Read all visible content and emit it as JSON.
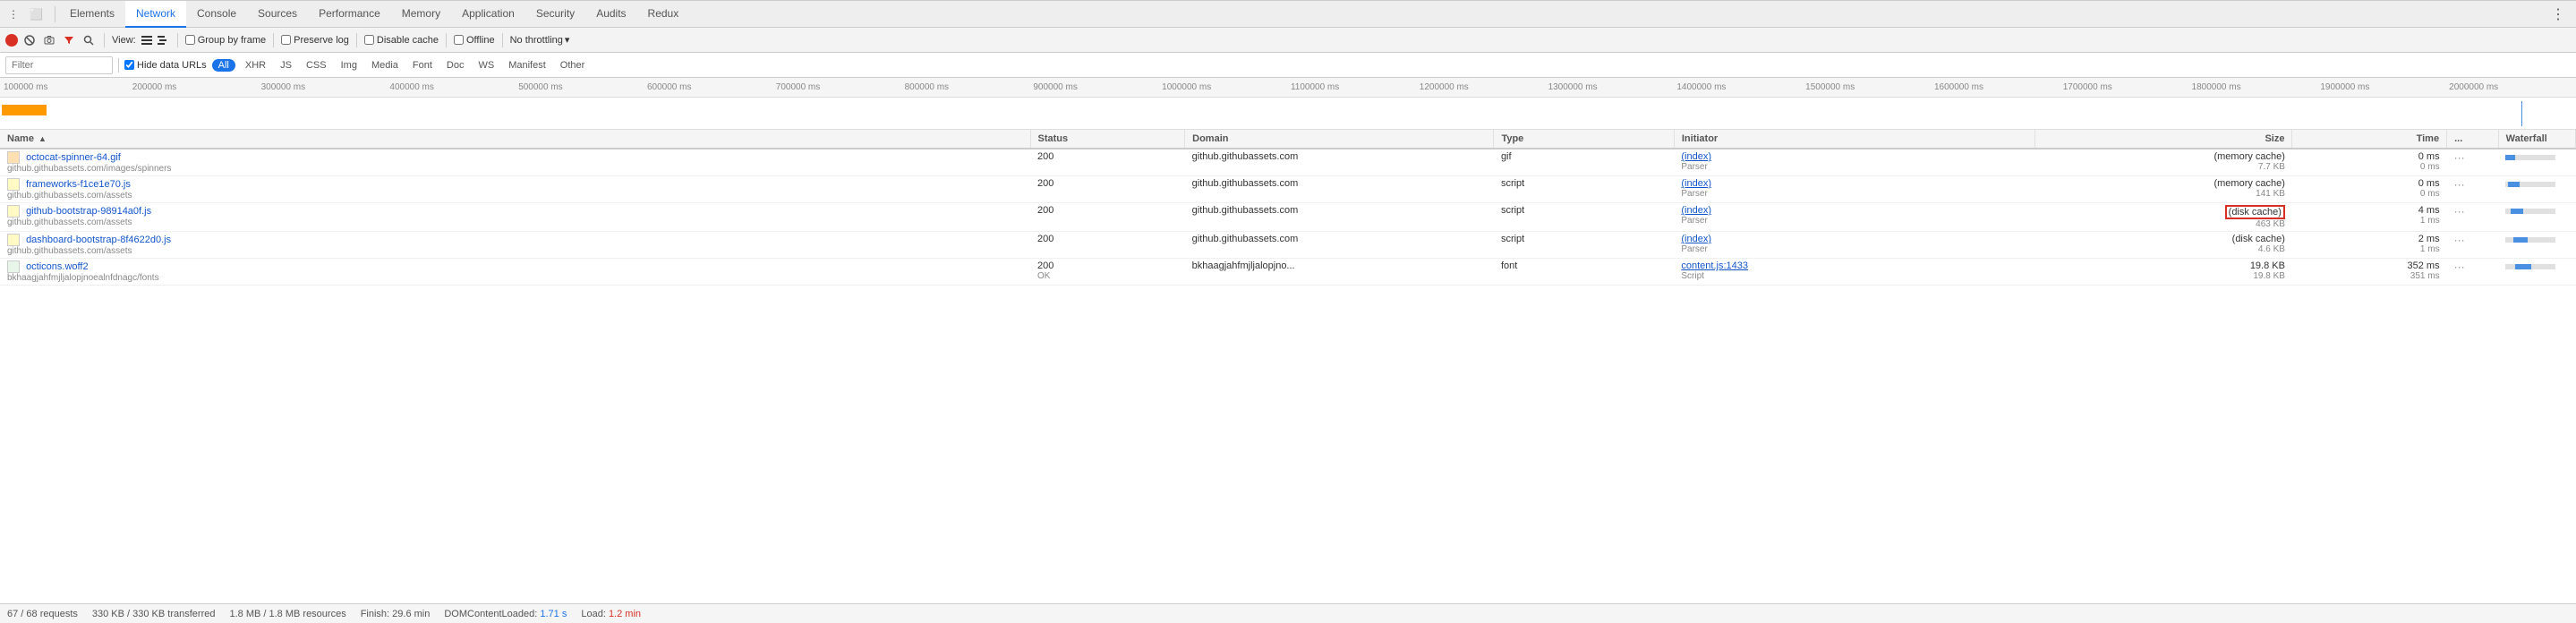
{
  "tabs": [
    {
      "id": "elements",
      "label": "Elements",
      "active": false
    },
    {
      "id": "network",
      "label": "Network",
      "active": true
    },
    {
      "id": "console",
      "label": "Console",
      "active": false
    },
    {
      "id": "sources",
      "label": "Sources",
      "active": false
    },
    {
      "id": "performance",
      "label": "Performance",
      "active": false
    },
    {
      "id": "memory",
      "label": "Memory",
      "active": false
    },
    {
      "id": "application",
      "label": "Application",
      "active": false
    },
    {
      "id": "security",
      "label": "Security",
      "active": false
    },
    {
      "id": "audits",
      "label": "Audits",
      "active": false
    },
    {
      "id": "redux",
      "label": "Redux",
      "active": false
    }
  ],
  "toolbar": {
    "view_label": "View:",
    "group_by_frame": "Group by frame",
    "preserve_log": "Preserve log",
    "disable_cache": "Disable cache",
    "offline": "Offline",
    "no_throttling": "No throttling"
  },
  "filter": {
    "placeholder": "Filter",
    "hide_data_urls": "Hide data URLs",
    "all_label": "All",
    "types": [
      "XHR",
      "JS",
      "CSS",
      "Img",
      "Media",
      "Font",
      "Doc",
      "WS",
      "Manifest",
      "Other"
    ]
  },
  "timeline": {
    "ticks": [
      "100000 ms",
      "200000 ms",
      "300000 ms",
      "400000 ms",
      "500000 ms",
      "600000 ms",
      "700000 ms",
      "800000 ms",
      "900000 ms",
      "1000000 ms",
      "1100000 ms",
      "1200000 ms",
      "1300000 ms",
      "1400000 ms",
      "1500000 ms",
      "1600000 ms",
      "1700000 ms",
      "1800000 ms",
      "1900000 ms",
      "2000000 ms"
    ]
  },
  "table": {
    "headers": [
      "Name",
      "Status",
      "Domain",
      "Type",
      "Initiator",
      "Size",
      "Time",
      "...",
      "Waterfall"
    ],
    "rows": [
      {
        "id": 1,
        "name": "octocat-spinner-64.gif",
        "path": "github.githubassets.com/images/spinners",
        "type_icon": "gif",
        "status": "200",
        "status_sub": "",
        "domain": "github.githubassets.com",
        "type": "gif",
        "initiator": "(index)",
        "initiator_sub": "Parser",
        "size_main": "(memory cache)",
        "size_sub": "7.7 KB",
        "time_main": "0 ms",
        "time_sub": "0 ms",
        "highlight": false
      },
      {
        "id": 2,
        "name": "frameworks-f1ce1e70.js",
        "path": "github.githubassets.com/assets",
        "type_icon": "script",
        "status": "200",
        "status_sub": "",
        "domain": "github.githubassets.com",
        "type": "script",
        "initiator": "(index)",
        "initiator_sub": "Parser",
        "size_main": "(memory cache)",
        "size_sub": "141 KB",
        "time_main": "0 ms",
        "time_sub": "0 ms",
        "highlight": false
      },
      {
        "id": 3,
        "name": "github-bootstrap-98914a0f.js",
        "path": "github.githubassets.com/assets",
        "type_icon": "script",
        "status": "200",
        "status_sub": "",
        "domain": "github.githubassets.com",
        "type": "script",
        "initiator": "(index)",
        "initiator_sub": "Parser",
        "size_main": "(disk cache)",
        "size_sub": "463 KB",
        "time_main": "4 ms",
        "time_sub": "1 ms",
        "highlight": true
      },
      {
        "id": 4,
        "name": "dashboard-bootstrap-8f4622d0.js",
        "path": "github.githubassets.com/assets",
        "type_icon": "script",
        "status": "200",
        "status_sub": "",
        "domain": "github.githubassets.com",
        "type": "script",
        "initiator": "(index)",
        "initiator_sub": "Parser",
        "size_main": "(disk cache)",
        "size_sub": "4.6 KB",
        "time_main": "2 ms",
        "time_sub": "1 ms",
        "highlight": false
      },
      {
        "id": 5,
        "name": "octicons.woff2",
        "path": "bkhaagjahfmjljalopjnoealnfdnagc/fonts",
        "type_icon": "font",
        "status": "200",
        "status_sub": "OK",
        "domain": "bkhaagjahfmjljalopjno...",
        "type": "font",
        "initiator": "content.js:1433",
        "initiator_sub": "Script",
        "size_main": "19.8 KB",
        "size_sub": "19.8 KB",
        "time_main": "352 ms",
        "time_sub": "351 ms",
        "highlight": false
      }
    ]
  },
  "status_bar": {
    "requests": "67 / 68 requests",
    "transferred": "330 KB / 330 KB transferred",
    "resources": "1.8 MB / 1.8 MB resources",
    "finish": "Finish: 29.6 min",
    "dom_content_loaded_label": "DOMContentLoaded:",
    "dom_content_loaded_value": "1.71 s",
    "load_label": "Load:",
    "load_value": "1.2 min"
  }
}
